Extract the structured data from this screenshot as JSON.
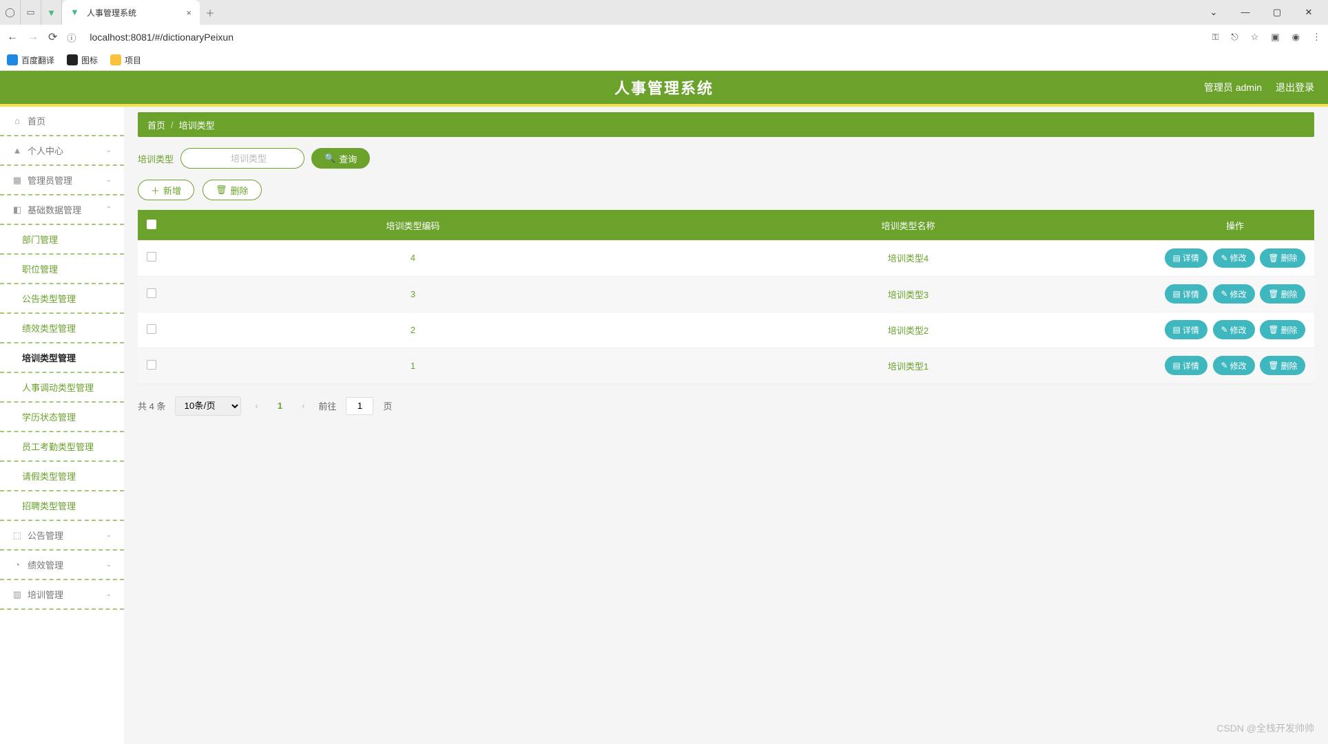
{
  "browser": {
    "tab_title": "人事管理系统",
    "url": "localhost:8081/#/dictionaryPeixun",
    "bookmarks": [
      {
        "label": "百度翻译",
        "icon": "blue"
      },
      {
        "label": "图标",
        "icon": "dark"
      },
      {
        "label": "项目",
        "icon": "yellow"
      }
    ]
  },
  "header": {
    "title": "人事管理系统",
    "user_role": "管理员 admin",
    "logout": "退出登录"
  },
  "sidebar": {
    "home": "首页",
    "personal": "个人中心",
    "admin": "管理员管理",
    "basic": "基础数据管理",
    "basic_items": [
      "部门管理",
      "职位管理",
      "公告类型管理",
      "绩效类型管理",
      "培训类型管理",
      "人事调动类型管理",
      "学历状态管理",
      "员工考勤类型管理",
      "请假类型管理",
      "招聘类型管理"
    ],
    "announce": "公告管理",
    "perf": "绩效管理",
    "training": "培训管理"
  },
  "breadcrumb": {
    "home": "首页",
    "current": "培训类型"
  },
  "search": {
    "label": "培训类型",
    "placeholder": "培训类型",
    "button": "查询"
  },
  "actions": {
    "add": "新增",
    "delete": "删除"
  },
  "table": {
    "headers": {
      "col1": "培训类型编码",
      "col2": "培训类型名称",
      "col3": "操作"
    },
    "rows": [
      {
        "code": "4",
        "name": "培训类型4"
      },
      {
        "code": "3",
        "name": "培训类型3"
      },
      {
        "code": "2",
        "name": "培训类型2"
      },
      {
        "code": "1",
        "name": "培训类型1"
      }
    ],
    "ops": {
      "detail": "详情",
      "edit": "修改",
      "delete": "删除"
    }
  },
  "pagination": {
    "total_prefix": "共 ",
    "total": "4",
    "total_suffix": " 条",
    "page_size": "10条/页",
    "current": "1",
    "goto_prefix": "前往",
    "goto_page": "1",
    "goto_suffix": "页"
  },
  "watermark": "CSDN @全栈开发帅帅"
}
